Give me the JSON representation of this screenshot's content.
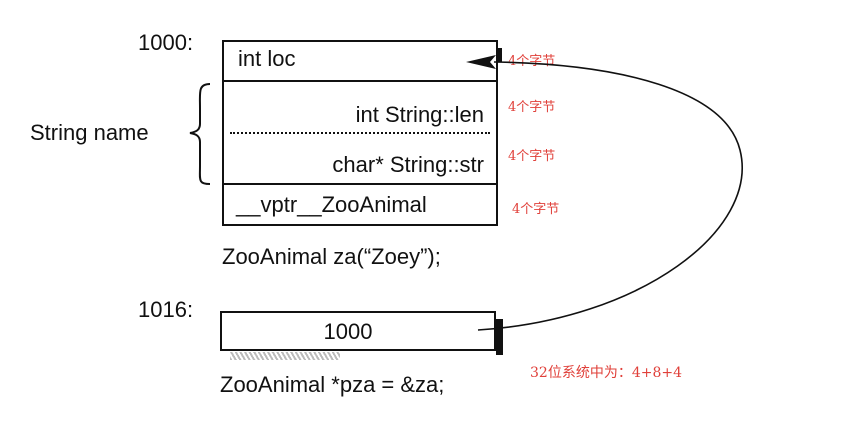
{
  "za_object": {
    "address": "1000:",
    "fields": [
      "int loc",
      "int String::len",
      "char* String::str",
      "__vptr__ZooAnimal"
    ],
    "declaration": "ZooAnimal za(“Zoey”);"
  },
  "string_member": {
    "label": "String name"
  },
  "pointer": {
    "address": "1016:",
    "value": "1000",
    "declaration": "ZooAnimal *pza = &za;"
  },
  "annotations": {
    "field_sizes": [
      "4个字节",
      "4个字节",
      "4个字节",
      "4个字节"
    ],
    "system_note": "32位系统中为：4+8+4"
  },
  "colors": {
    "annotation": "#e0403a",
    "ink": "#111111"
  }
}
